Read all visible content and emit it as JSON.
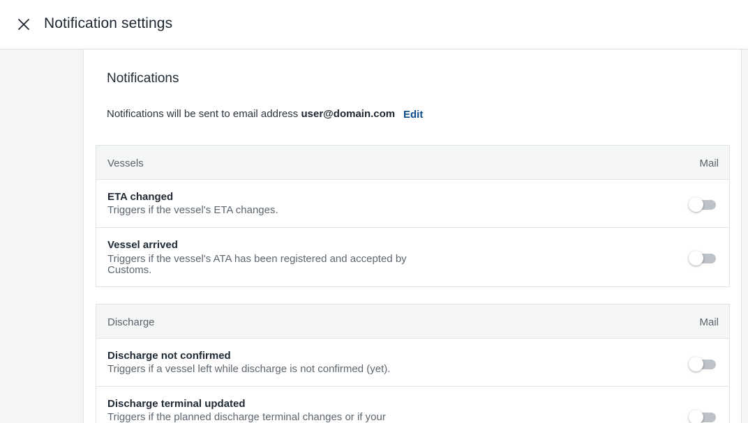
{
  "header": {
    "title": "Notification settings",
    "close_icon": "close-icon"
  },
  "notifications": {
    "title": "Notifications",
    "email_prefix": "Notifications will be sent to email address ",
    "email": "user@domain.com",
    "edit_label": "Edit"
  },
  "groups": [
    {
      "name": "Vessels",
      "column": "Mail",
      "items": [
        {
          "title": "ETA changed",
          "description": "Triggers if the vessel's ETA changes.",
          "enabled": false
        },
        {
          "title": "Vessel arrived",
          "description": "Triggers if the vessel's ATA has been registered and accepted by Customs.",
          "enabled": false
        }
      ]
    },
    {
      "name": "Discharge",
      "column": "Mail",
      "items": [
        {
          "title": "Discharge not confirmed",
          "description": "Triggers if a vessel left while discharge is not confirmed (yet).",
          "enabled": false
        },
        {
          "title": "Discharge terminal updated",
          "description": "Triggers if the planned discharge terminal changes or if your",
          "enabled": false
        }
      ]
    }
  ],
  "colors": {
    "accent": "#0b4a8b",
    "toggle_off": "#bcc2c7"
  }
}
